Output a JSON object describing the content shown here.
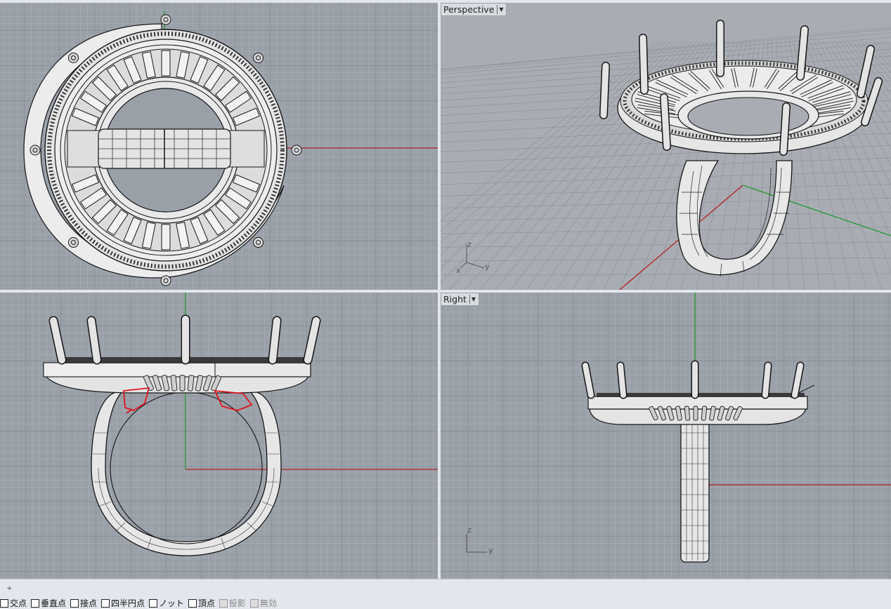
{
  "viewports": {
    "top": {
      "label": ""
    },
    "perspective": {
      "label": "Perspective",
      "dropdown_icon": "chevron-down-icon"
    },
    "front": {
      "label": ""
    },
    "right": {
      "label": "Right",
      "dropdown_icon": "chevron-down-icon"
    }
  },
  "axis_gizmo": {
    "perspective": {
      "z": "z",
      "x": "x",
      "y": "y"
    },
    "right": {
      "z": "z",
      "y": "y"
    }
  },
  "statusbar": {
    "crosshair_icon": "crosshair-icon",
    "osnaps": [
      {
        "label": "交点",
        "checked": false,
        "enabled": true
      },
      {
        "label": "垂直点",
        "checked": false,
        "enabled": true
      },
      {
        "label": "接点",
        "checked": false,
        "enabled": true
      },
      {
        "label": "四半円点",
        "checked": false,
        "enabled": true
      },
      {
        "label": "ノット",
        "checked": false,
        "enabled": true
      },
      {
        "label": "頂点",
        "checked": false,
        "enabled": true
      },
      {
        "label": "投影",
        "checked": false,
        "enabled": false
      },
      {
        "label": "無効",
        "checked": false,
        "enabled": false
      }
    ]
  },
  "colors": {
    "viewport_bg": "#9aa0a8",
    "grid_minor": "#a5aab2",
    "grid_major": "#8c9199",
    "x_axis": "#b02020",
    "y_axis": "#1e9a2e",
    "wire": "#151515",
    "surface": "#e8e8e8",
    "markup": "#e0141e"
  }
}
